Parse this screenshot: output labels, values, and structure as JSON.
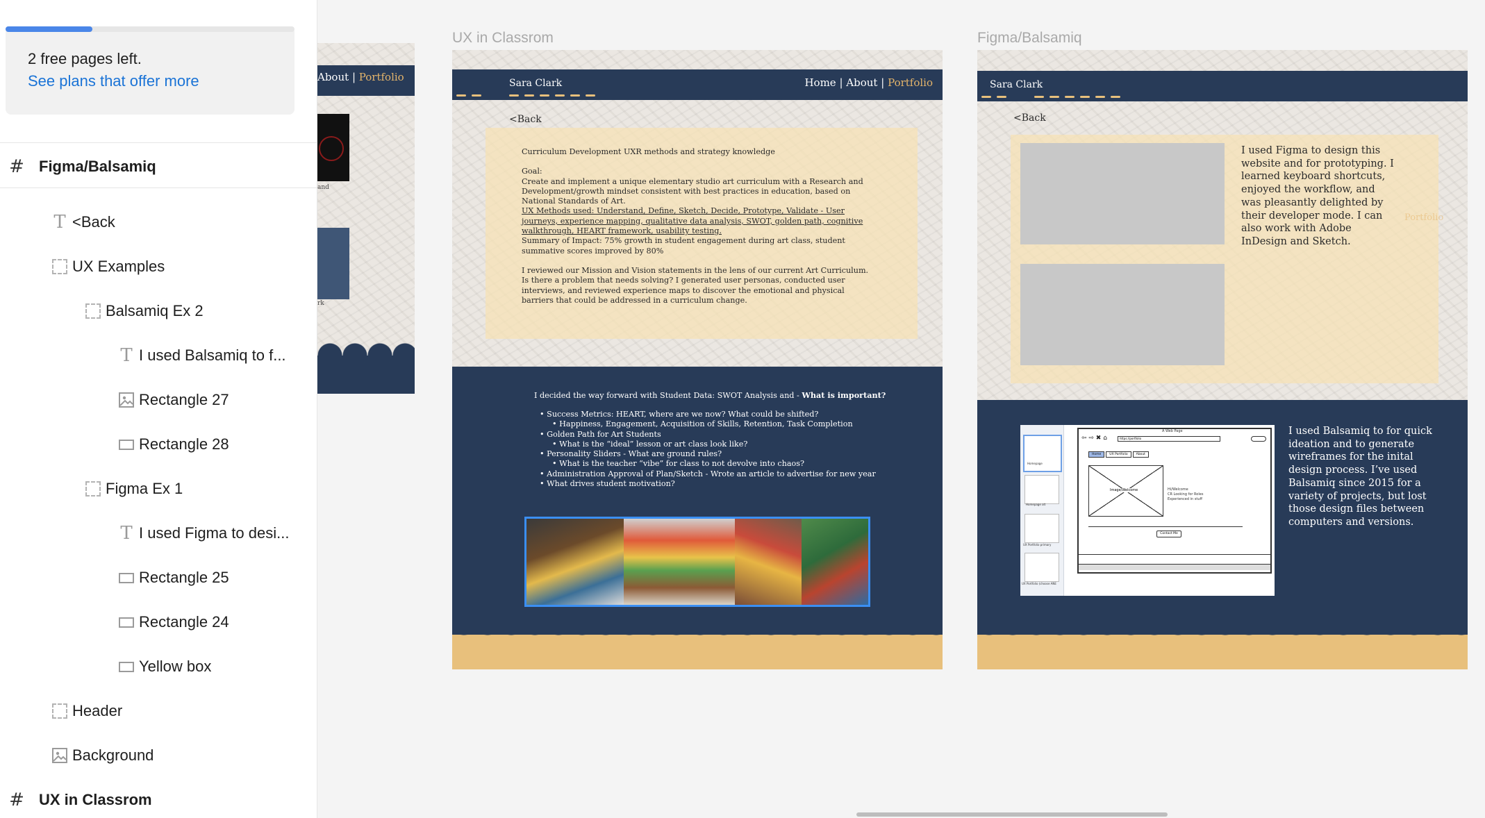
{
  "sidebar": {
    "progress_percent": 30,
    "promo": {
      "text": "2 free pages left.",
      "link": "See plans that offer more"
    },
    "layers": [
      {
        "label": "Figma/Balsamiq",
        "icon": "frame-hash-icon",
        "depth": 0,
        "type": "frame"
      },
      {
        "label": "<Back",
        "icon": "text-icon",
        "depth": 1,
        "type": "text"
      },
      {
        "label": "UX Examples",
        "icon": "group-icon",
        "depth": 1,
        "type": "group"
      },
      {
        "label": "Balsamiq Ex 2",
        "icon": "group-icon",
        "depth": 2,
        "type": "group"
      },
      {
        "label": "I used Balsamiq to f...",
        "icon": "text-icon",
        "depth": 3,
        "type": "text"
      },
      {
        "label": "Rectangle 27",
        "icon": "image-icon",
        "depth": 3,
        "type": "image"
      },
      {
        "label": "Rectangle 28",
        "icon": "rectangle-icon",
        "depth": 3,
        "type": "rectangle"
      },
      {
        "label": "Figma Ex 1",
        "icon": "group-icon",
        "depth": 2,
        "type": "group"
      },
      {
        "label": "I used Figma to desi...",
        "icon": "text-icon",
        "depth": 3,
        "type": "text"
      },
      {
        "label": "Rectangle 25",
        "icon": "rectangle-icon",
        "depth": 3,
        "type": "rectangle"
      },
      {
        "label": "Rectangle 24",
        "icon": "rectangle-icon",
        "depth": 3,
        "type": "rectangle"
      },
      {
        "label": "Yellow box",
        "icon": "rectangle-icon",
        "depth": 3,
        "type": "rectangle"
      },
      {
        "label": "Header",
        "icon": "group-icon",
        "depth": 1,
        "type": "group"
      },
      {
        "label": "Background",
        "icon": "image-icon",
        "depth": 1,
        "type": "image"
      },
      {
        "label": "UX in Classrom",
        "icon": "frame-hash-icon",
        "depth": 0,
        "type": "frame"
      }
    ]
  },
  "canvas": {
    "partial_frame": {
      "nav_about": "About",
      "nav_sep": "|",
      "nav_portfolio": "Portfolio",
      "caption1": "and",
      "caption2": "rk"
    },
    "frame_classroom": {
      "title": "UX in Classrom",
      "site_name": "Sara Clark",
      "nav_home": "Home",
      "nav_sep": "|",
      "nav_about": "About",
      "nav_portfolio": "Portfolio",
      "back": "<Back",
      "heading": "Curriculum Development UXR methods and strategy knowledge",
      "goal_label": "Goal:",
      "goal_text": "Create and implement a unique elementary studio art curriculum with a Research and Development/growth mindset consistent with best practices in education, based on National Standards of Art.",
      "methods_text": "UX Methods used: Understand, Define, Sketch, Decide, Prototype, Validate - User journeys, experience mapping, qualitative data analysis, SWOT, golden path, cognitive walkthrough, HEART framework, usability testing.",
      "impact_text": "Summary of Impact: 75% growth in student engagement during art class, student summative scores improved by 80%",
      "review_text": "I reviewed our Mission and Vision statements in the lens of our current Art Curriculum. Is there a problem that needs solving? I generated user personas, conducted user interviews, and reviewed experience maps to discover the emotional and physical barriers that could be addressed in a curriculum change.",
      "swot_intro": "I decided the way forward with Student Data: SWOT Analysis and -",
      "swot_bold": "What is important?",
      "bullets": [
        {
          "text": "Success Metrics: HEART, where are we now? What could be shifted?",
          "level": 1
        },
        {
          "text": "Happiness, Engagement, Acquisition of Skills, Retention, Task Completion",
          "level": 2
        },
        {
          "text": "Golden Path for Art Students",
          "level": 1
        },
        {
          "text": "What is the “ideal” lesson or art class look like?",
          "level": 2
        },
        {
          "text": "Personality Sliders - What are ground rules?",
          "level": 1
        },
        {
          "text": "What is the teacher “vibe” for class to not devolve into chaos?",
          "level": 2
        },
        {
          "text": "Administration Approval of Plan/Sketch - Wrote an article to advertise for new year",
          "level": 1
        },
        {
          "text": "What drives student motivation?",
          "level": 1
        }
      ]
    },
    "frame_figma": {
      "title": "Figma/Balsamiq",
      "site_name": "Sara Clark",
      "back": "<Back",
      "ghost_portfolio": "Portfolio",
      "figma_text": "I used Figma to design this website and for prototyping. I learned keyboard shortcuts, enjoyed the workflow, and was pleasantly delighted by their developer mode. I can also work with Adobe InDesign and Sketch.",
      "balsamiq_text": "I used Balsamiq to for quick ideation and to generate wireframes for  the inital design process. I’ve used Balsamiq since 2015 for a variety of projects, but lost those design files between computers and versions.",
      "wireframe": {
        "window_title": "A Web Page",
        "url": "https://portfolio",
        "tabs": [
          "Home",
          "UX Portfolio",
          "About"
        ],
        "image_label": "Image/Welcome",
        "welcome_lines": [
          "Hi/Welcome",
          "CR Looking for Roles",
          "Experienced in stuff"
        ],
        "button": "Contact Me",
        "pages": [
          "Homepage",
          "Homepage alt",
          "UX Portfolio primary",
          "UX Portfolio (choose ANE"
        ]
      }
    }
  }
}
